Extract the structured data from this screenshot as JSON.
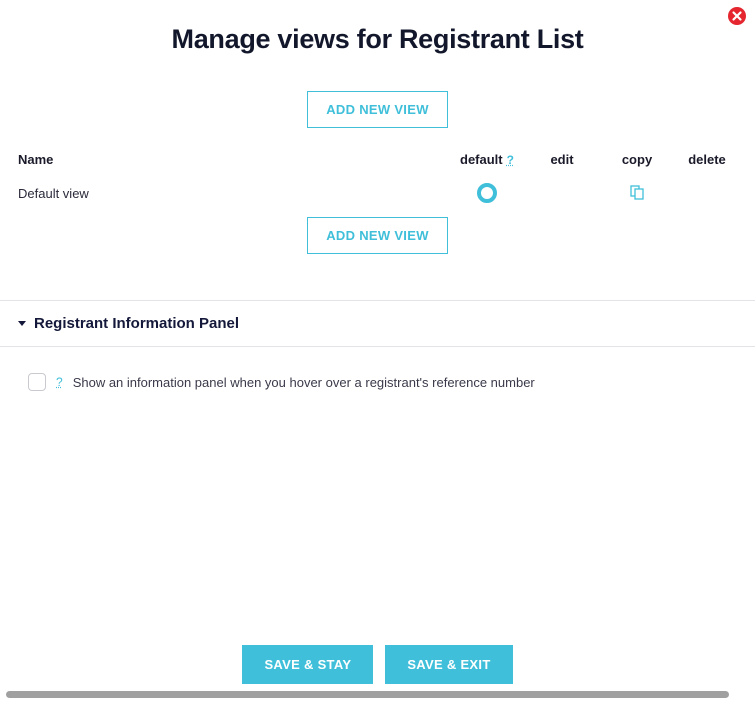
{
  "modal": {
    "title": "Manage views for Registrant List"
  },
  "buttons": {
    "addNewView": "ADD NEW VIEW",
    "saveStay": "SAVE & STAY",
    "saveExit": "SAVE & EXIT"
  },
  "columns": {
    "name": "Name",
    "default": "default",
    "edit": "edit",
    "copy": "copy",
    "delete": "delete"
  },
  "views": [
    {
      "name": "Default view",
      "isDefault": true
    }
  ],
  "section": {
    "title": "Registrant Information Panel",
    "helpText": "?",
    "checkboxLabel": "Show an information panel when you hover over a registrant's reference number"
  },
  "icons": {
    "help": "?"
  }
}
